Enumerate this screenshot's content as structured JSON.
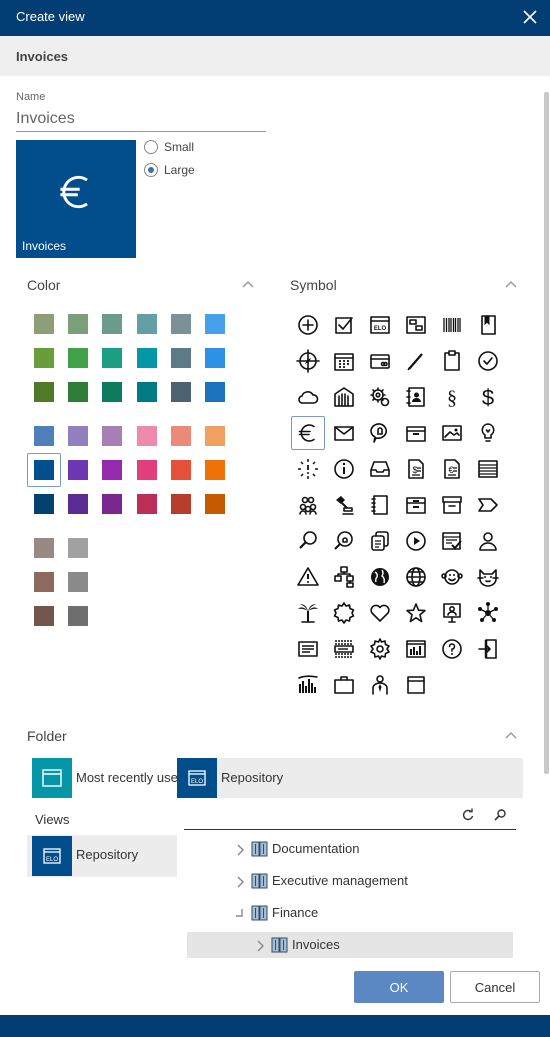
{
  "dialog": {
    "title": "Create view",
    "subtitle": "Invoices"
  },
  "name_field": {
    "label": "Name",
    "value": "Invoices"
  },
  "preview": {
    "label": "Invoices",
    "icon": "euro-icon"
  },
  "size_options": [
    {
      "label": "Small",
      "selected": false
    },
    {
      "label": "Large",
      "selected": true
    }
  ],
  "color_section": {
    "title": "Color",
    "rows": [
      [
        "#8c9f79",
        "#7c9f7a",
        "#6b9b8a",
        "#649fa4",
        "#7c9097",
        "#46a0ec"
      ],
      [
        "#679d3b",
        "#3fa148",
        "#1c9e82",
        "#0597a7",
        "#5e7a88",
        "#2d91e6"
      ],
      [
        "#4f7b29",
        "#2f7c37",
        "#0e7b5f",
        "#007a83",
        "#4b6270",
        "#1e73be"
      ],
      [
        "#4f80b8",
        "#9381bf",
        "#a87fb5",
        "#ef8aad",
        "#ec8a79",
        "#f0a160"
      ],
      [
        "#04508f",
        "#6d37b2",
        "#962aae",
        "#e33f7e",
        "#e5503a",
        "#ee7208"
      ],
      [
        "#034270",
        "#5b2d92",
        "#7c2790",
        "#bc2d58",
        "#b73d2c",
        "#c45a02"
      ],
      [
        "#968a83",
        "#a1a1a1"
      ],
      [
        "#8c6b5e",
        "#8a8a8a"
      ],
      [
        "#72564c",
        "#6e6e6e"
      ]
    ],
    "selected": "#04508f"
  },
  "symbol_section": {
    "title": "Symbol",
    "selected": "euro-icon",
    "rows": [
      [
        "plus-circle-icon",
        "checkbox-icon",
        "elo-card-icon",
        "transfer-icon",
        "barcode-icon",
        "book-icon"
      ],
      [
        "compass-icon",
        "calendar-icon",
        "credit-card-icon",
        "pen-icon",
        "clipboard-icon",
        "check-circle-icon"
      ],
      [
        "cloud-icon",
        "building-icon",
        "gears-icon",
        "contact-book-icon",
        "paragraph-icon",
        "dollar-icon"
      ],
      [
        "euro-icon",
        "mail-icon",
        "speech-bulb-icon",
        "drawer-icon",
        "image-icon",
        "lightbulb-icon"
      ],
      [
        "burst-icon",
        "info-icon",
        "inbox-icon",
        "invoice-dollar-icon",
        "invoice-euro-icon",
        "ledger-icon"
      ],
      [
        "group-icon",
        "stamp-icon",
        "notebook-icon",
        "archive-box-icon",
        "archive-tray-icon",
        "tag-arrow-icon"
      ],
      [
        "search-icon",
        "search-bulb-icon",
        "documents-icon",
        "play-circle-icon",
        "checklist-icon",
        "person-icon"
      ],
      [
        "warning-icon",
        "org-chart-icon",
        "globe-icon",
        "grid-globe-icon",
        "monkey-icon",
        "cat-icon"
      ],
      [
        "palm-tree-icon",
        "seal-icon",
        "heart-icon",
        "star-icon",
        "presenter-icon",
        "network-icon"
      ],
      [
        "id-card-icon",
        "list-card-icon",
        "settings-icon",
        "report-chart-icon",
        "help-circle-icon",
        "exit-door-icon"
      ],
      [
        "bar-chart-icon",
        "briefcase-icon",
        "businessman-icon",
        "window-icon"
      ]
    ]
  },
  "folder_section": {
    "title": "Folder",
    "recent_label": "Most recently used",
    "repository_header": "Repository",
    "views_label": "Views",
    "views_item": "Repository",
    "tree": [
      {
        "label": "Documentation",
        "level": 0,
        "state": "collapsed"
      },
      {
        "label": "Executive management",
        "level": 0,
        "state": "collapsed"
      },
      {
        "label": "Finance",
        "level": 0,
        "state": "expanded"
      },
      {
        "label": "Invoices",
        "level": 1,
        "state": "selected"
      }
    ]
  },
  "buttons": {
    "ok": "OK",
    "cancel": "Cancel"
  },
  "colors": {
    "primary": "#023e74",
    "tile": "#024e8c",
    "button": "#5b88c2",
    "teal_tile": "#0597a7"
  }
}
